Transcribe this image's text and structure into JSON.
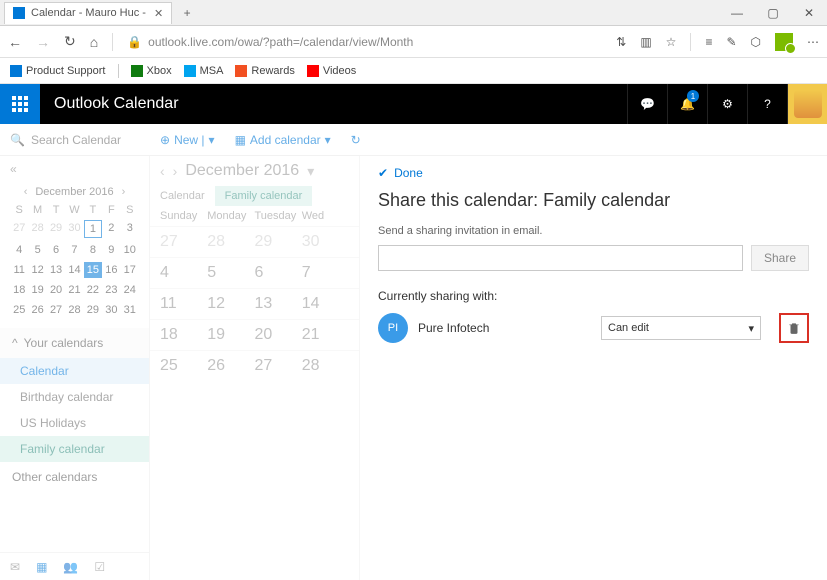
{
  "browser": {
    "tab_title": "Calendar - Mauro Huc -",
    "url": "outlook.live.com/owa/?path=/calendar/view/Month"
  },
  "favorites": [
    {
      "label": "Product Support",
      "color": "#0078d7"
    },
    {
      "label": "Xbox",
      "color": "#107c10"
    },
    {
      "label": "MSA",
      "color": "#00a4ef"
    },
    {
      "label": "Rewards",
      "color": "#f25022"
    },
    {
      "label": "Videos",
      "color": "#ff0000"
    }
  ],
  "app": {
    "title": "Outlook Calendar",
    "notification_count": "1"
  },
  "toolbar": {
    "search_placeholder": "Search Calendar",
    "new_label": "New |",
    "add_calendar_label": "Add calendar"
  },
  "miniCalendar": {
    "month_label": "December 2016",
    "dow": [
      "S",
      "M",
      "T",
      "W",
      "T",
      "F",
      "S"
    ],
    "days": [
      {
        "n": "27",
        "out": true
      },
      {
        "n": "28",
        "out": true
      },
      {
        "n": "29",
        "out": true
      },
      {
        "n": "30",
        "out": true
      },
      {
        "n": "1",
        "today": true
      },
      {
        "n": "2"
      },
      {
        "n": "3"
      },
      {
        "n": "4"
      },
      {
        "n": "5"
      },
      {
        "n": "6"
      },
      {
        "n": "7"
      },
      {
        "n": "8"
      },
      {
        "n": "9"
      },
      {
        "n": "10"
      },
      {
        "n": "11"
      },
      {
        "n": "12"
      },
      {
        "n": "13"
      },
      {
        "n": "14"
      },
      {
        "n": "15",
        "sel": true
      },
      {
        "n": "16"
      },
      {
        "n": "17"
      },
      {
        "n": "18"
      },
      {
        "n": "19"
      },
      {
        "n": "20"
      },
      {
        "n": "21"
      },
      {
        "n": "22"
      },
      {
        "n": "23"
      },
      {
        "n": "24"
      },
      {
        "n": "25"
      },
      {
        "n": "26"
      },
      {
        "n": "27"
      },
      {
        "n": "28"
      },
      {
        "n": "29"
      },
      {
        "n": "30"
      },
      {
        "n": "31"
      }
    ]
  },
  "sections": {
    "your_calendars": "Your calendars",
    "other_calendars": "Other calendars"
  },
  "calendars": [
    {
      "name": "Calendar",
      "style": "sel"
    },
    {
      "name": "Birthday calendar",
      "style": ""
    },
    {
      "name": "US Holidays",
      "style": ""
    },
    {
      "name": "Family calendar",
      "style": "teal"
    }
  ],
  "monthView": {
    "title": "December 2016",
    "tabs": [
      {
        "label": "Calendar",
        "active": false
      },
      {
        "label": "Family calendar",
        "active": true
      }
    ],
    "dow": [
      "Sunday",
      "Monday",
      "Tuesday",
      "Wed"
    ],
    "weeks": [
      [
        "27",
        "28",
        "29",
        "30"
      ],
      [
        "4",
        "5",
        "6",
        "7"
      ],
      [
        "11",
        "12",
        "13",
        "14"
      ],
      [
        "18",
        "19",
        "20",
        "21"
      ],
      [
        "25",
        "26",
        "27",
        "28"
      ]
    ]
  },
  "share": {
    "done_label": "Done",
    "title": "Share this calendar: Family calendar",
    "hint": "Send a sharing invitation in email.",
    "share_button": "Share",
    "currently_label": "Currently sharing with:",
    "person": {
      "initials": "PI",
      "name": "Pure Infotech",
      "permission": "Can edit"
    }
  }
}
